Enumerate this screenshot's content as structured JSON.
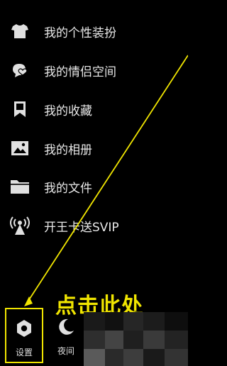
{
  "menu": {
    "items": [
      {
        "label": "我的个性装扮",
        "icon": "tshirt-icon"
      },
      {
        "label": "我的情侣空间",
        "icon": "heart-bubble-icon"
      },
      {
        "label": "我的收藏",
        "icon": "bookmark-icon"
      },
      {
        "label": "我的相册",
        "icon": "image-icon"
      },
      {
        "label": "我的文件",
        "icon": "folder-icon"
      },
      {
        "label": "开王卡送SVIP",
        "icon": "signal-tower-icon"
      }
    ]
  },
  "annotation": {
    "hint_text": "点击此处",
    "color": "#f0e500"
  },
  "bottom_bar": {
    "settings_label": "设置",
    "night_label": "夜间"
  }
}
